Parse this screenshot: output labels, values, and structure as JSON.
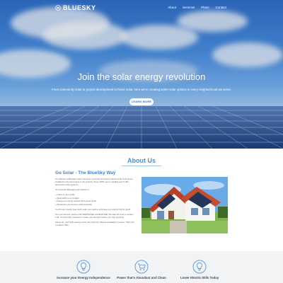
{
  "brand": {
    "name": "BLUESKY"
  },
  "nav": {
    "items": [
      "About",
      "Services",
      "Plans",
      "Contact"
    ]
  },
  "hero": {
    "title": "Join the solar energy revolution",
    "subtitle": "From community solar to project development to home solar, here we're creating better solar options in every neighborhood we serve.",
    "button_label": "LEARN MORE"
  },
  "about": {
    "heading": "About Us",
    "section_title": "Go Solar - The BlueSky Way",
    "intro": "Our Mission at BlueSky Solar has been to provide the best products at the best prices installed by the best teams in the industry. Since 2009, we've installed over 5,000 successful solar systems.",
    "list_heading": "Our Account Managers are trained to:",
    "bullets": [
      "+ Listen to your goals",
      "+ Work within your budget",
      "+ Design an energy solution that meets goals",
      "+ Streamline your home's solar potential"
    ],
    "p2": "You'll know exactly how much solar you need to eliminate your electric bill for good!",
    "p3": "Our commitment means a NO PRESSURE GUARANTEE. We take the time to explain it all. You'll be fully prepared to make your decision before you sign anything.",
    "p4": "Above all, you'll start saving money fast with our efficient installation process. That's the Longhorn Way."
  },
  "features": [
    {
      "title": "Increase your Energy Independence",
      "icon": "lightbulb-icon"
    },
    {
      "title": "Power that's Abundant and Clean",
      "icon": "shopping-cart-icon"
    },
    {
      "title": "Lower Electric Bills Today",
      "icon": "lightbulb-icon"
    }
  ],
  "colors": {
    "accent": "#3b86d9",
    "feature_bg": "#f2f3f5",
    "icon_blue": "#5b9fe0"
  }
}
